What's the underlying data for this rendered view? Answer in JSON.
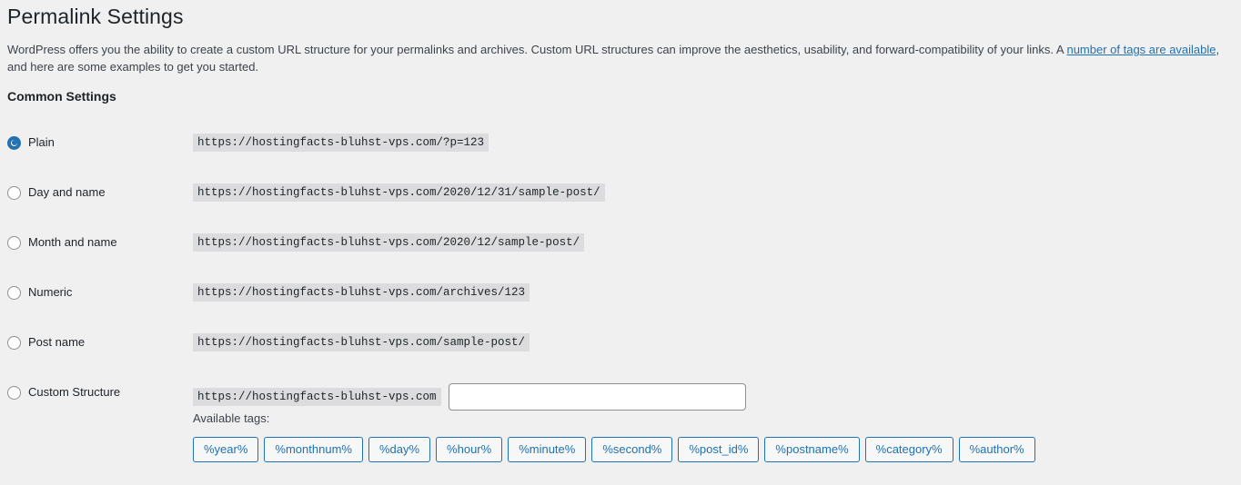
{
  "page": {
    "title": "Permalink Settings",
    "intro_before_link": "WordPress offers you the ability to create a custom URL structure for your permalinks and archives. Custom URL structures can improve the aesthetics, usability, and forward-compatibility of your links. A ",
    "intro_link_text": "number of tags are available",
    "intro_after_link": ", and here are some examples to get you started.",
    "section_heading": "Common Settings"
  },
  "settings": {
    "options": [
      {
        "label": "Plain",
        "example": "https://hostingfacts-bluhst-vps.com/?p=123",
        "selected": true
      },
      {
        "label": "Day and name",
        "example": "https://hostingfacts-bluhst-vps.com/2020/12/31/sample-post/",
        "selected": false
      },
      {
        "label": "Month and name",
        "example": "https://hostingfacts-bluhst-vps.com/2020/12/sample-post/",
        "selected": false
      },
      {
        "label": "Numeric",
        "example": "https://hostingfacts-bluhst-vps.com/archives/123",
        "selected": false
      },
      {
        "label": "Post name",
        "example": "https://hostingfacts-bluhst-vps.com/sample-post/",
        "selected": false
      },
      {
        "label": "Custom Structure",
        "example": "https://hostingfacts-bluhst-vps.com",
        "selected": false,
        "input_value": "",
        "input_placeholder": ""
      }
    ]
  },
  "tags": {
    "label": "Available tags:",
    "items": [
      "%year%",
      "%monthnum%",
      "%day%",
      "%hour%",
      "%minute%",
      "%second%",
      "%post_id%",
      "%postname%",
      "%category%",
      "%author%"
    ]
  },
  "colors": {
    "background": "#f0f0f1",
    "accent": "#2271b1",
    "text": "#3c434a",
    "heading": "#1d2327",
    "code_chip_bg": "#dcdcde"
  }
}
